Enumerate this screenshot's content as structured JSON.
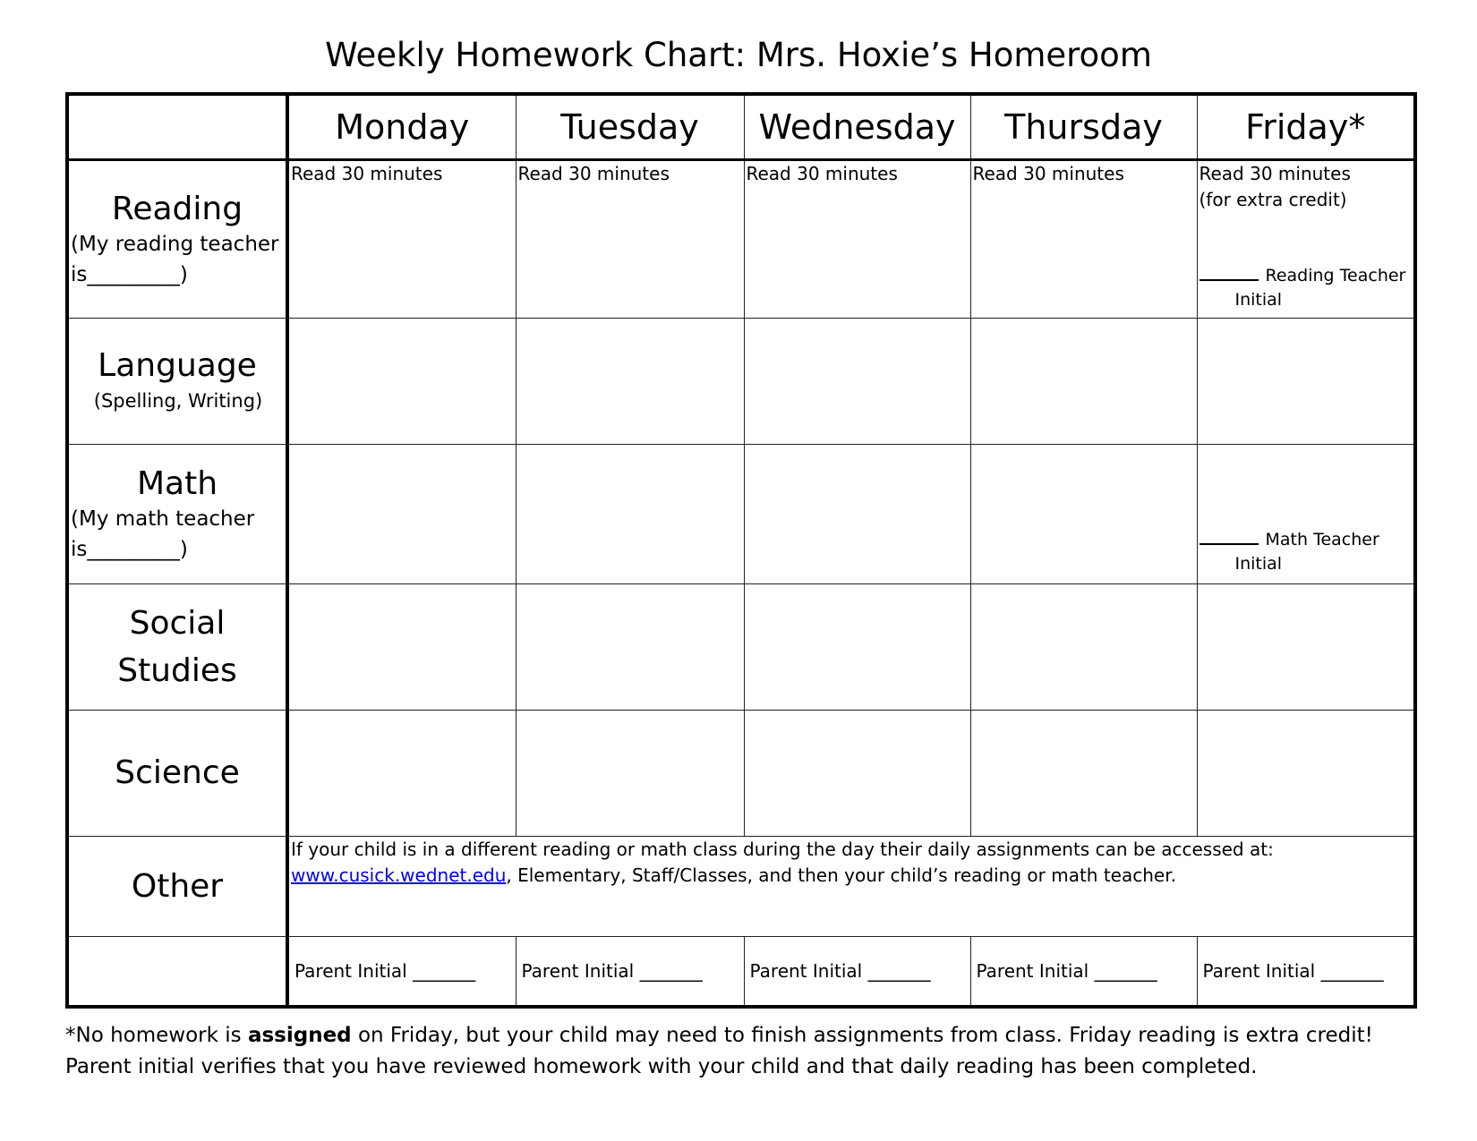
{
  "title": "Weekly Homework Chart: Mrs. Hoxie’s Homeroom",
  "days": [
    "Monday",
    "Tuesday",
    "Wednesday",
    "Thursday",
    "Friday*"
  ],
  "rows": {
    "reading": {
      "label": "Reading",
      "note_line1": "(My reading teacher",
      "note_line2": "is_________)",
      "daily": [
        "Read 30 minutes",
        "Read 30 minutes",
        "Read 30 minutes",
        "Read 30 minutes",
        "Read 30 minutes"
      ],
      "friday_extra": "(for extra credit)",
      "teacher_initial_label": "Reading Teacher",
      "teacher_initial_suffix": "Initial"
    },
    "language": {
      "label": "Language",
      "note": "(Spelling, Writing)"
    },
    "math": {
      "label": "Math",
      "note_line1": "(My math teacher",
      "note_line2": "is_________)",
      "teacher_initial_label": "Math Teacher",
      "teacher_initial_suffix": "Initial"
    },
    "social": {
      "label_line1": "Social",
      "label_line2": "Studies"
    },
    "science": {
      "label": "Science"
    },
    "other": {
      "label": "Other",
      "text_line1": "If your child is in a different reading or math class during the day their daily assignments can be accessed at:",
      "link": "www.cusick.wednet.edu",
      "text_line2": ", Elementary, Staff/Classes, and then your child’s reading or math teacher."
    },
    "parent": {
      "label": "Parent Initial _______"
    }
  },
  "footer": {
    "line1_pre": "*No homework is ",
    "line1_bold": "assigned",
    "line1_post": " on Friday, but your child may need to finish assignments from class. Friday reading is extra credit!",
    "line2": "Parent initial verifies that you have reviewed homework with your child and that daily reading has been completed."
  }
}
